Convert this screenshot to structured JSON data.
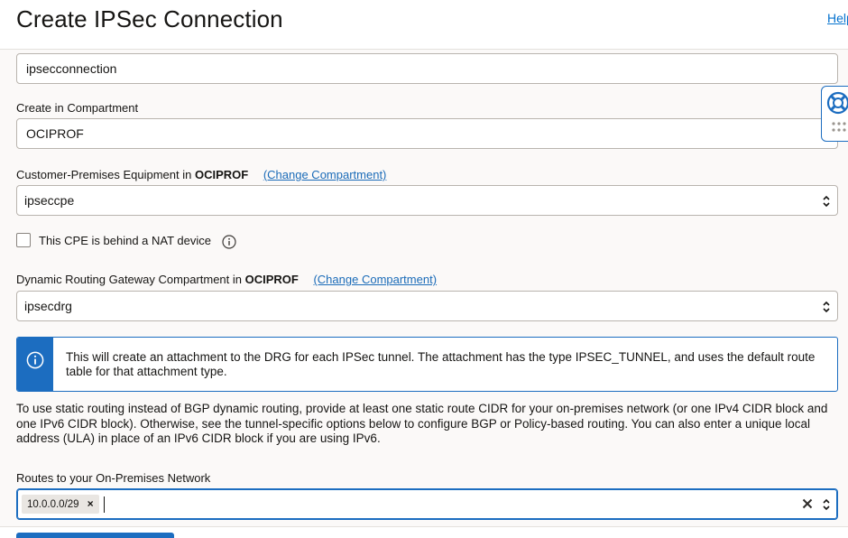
{
  "header": {
    "title": "Create IPSec Connection",
    "help_link": "Help"
  },
  "form": {
    "name_value": "ipsecconnection",
    "compartment": {
      "label": "Create in Compartment",
      "value": "OCIPROF"
    },
    "cpe": {
      "label_prefix": "Customer-Premises Equipment in ",
      "label_compartment": "OCIPROF",
      "change_link": "(Change Compartment)",
      "value": "ipseccpe"
    },
    "nat_checkbox": {
      "label": "This CPE is behind a NAT device",
      "checked": false
    },
    "drg": {
      "label_prefix": "Dynamic Routing Gateway Compartment in ",
      "label_compartment": "OCIPROF",
      "change_link": "(Change Compartment)",
      "value": "ipsecdrg"
    },
    "info_banner": {
      "text": "This will create an attachment to the DRG for each IPSec tunnel. The attachment has the type IPSEC_TUNNEL, and uses the default route table for that attachment type."
    },
    "static_routing_help": "To use static routing instead of BGP dynamic routing, provide at least one static route CIDR for your on-premises network (or one IPv4 CIDR block and one IPv6 CIDR block). Otherwise, see the tunnel-specific options below to configure BGP or Policy-based routing. You can also enter a unique local address (ULA) in place of an IPv6 CIDR block if you are using IPv6.",
    "routes": {
      "label": "Routes to your On-Premises Network",
      "chips": [
        "10.0.0.0/29"
      ],
      "chip_remove_glyph": "×"
    }
  },
  "colors": {
    "accent": "#1c6dc0",
    "link": "#0572ce",
    "text": "#161513",
    "background": "#fbf9f8"
  },
  "icons": [
    "info-icon",
    "chevron-updown-icon",
    "clear-icon",
    "lifebuoy-icon",
    "grip-icon"
  ]
}
